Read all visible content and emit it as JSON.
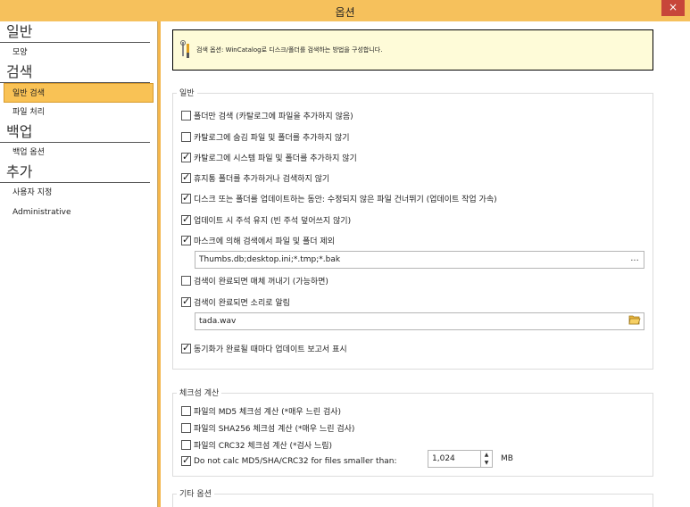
{
  "window": {
    "title": "옵션",
    "close_label": "×"
  },
  "sidebar": {
    "groups": [
      {
        "title": "일반",
        "items": [
          "모양"
        ]
      },
      {
        "title": "검색",
        "items": [
          "일반 검색",
          "파일 처리"
        ]
      },
      {
        "title": "백업",
        "items": [
          "백업 옵션"
        ]
      },
      {
        "title": "추가",
        "items": [
          "사용자 지정",
          "Administrative"
        ]
      }
    ],
    "active_item": "일반 검색"
  },
  "info": {
    "text": "검색 옵션: WinCatalog로 디스크/폴더를 검색하는 방법을 구성합니다."
  },
  "general": {
    "legend": "일반",
    "options": [
      {
        "label": "폴더만 검색 (카탈로그에 파일을 추가하지 않음)",
        "checked": false
      },
      {
        "label": "카탈로그에 숨김 파일 및 폴더를 추가하지 않기",
        "checked": false
      },
      {
        "label": "카탈로그에 시스템 파일 및 폴더를 추가하지 않기",
        "checked": true
      },
      {
        "label": "휴지통 폴더를 추가하거나 검색하지 않기",
        "checked": true
      },
      {
        "label": "디스크 또는 폴더를 업데이트하는 동안: 수정되지 않은 파일 건너뛰기 (업데이트 작업 가속)",
        "checked": true
      },
      {
        "label": "업데이트 시 주석 유지 (빈 주석 덮어쓰지 않기)",
        "checked": true
      },
      {
        "label": "마스크에 의해 검색에서 파일 및 폴더 제외",
        "checked": true
      },
      {
        "label": "검색이 완료되면 매체 꺼내기 (가능하면)",
        "checked": false
      },
      {
        "label": "검색이 완료되면 소리로 알림",
        "checked": true
      },
      {
        "label": "동기화가 완료될 때마다 업데이트 보고서 표시",
        "checked": true
      }
    ],
    "mask_value": "Thumbs.db;desktop.ini;*.tmp;*.bak",
    "mask_button": "...",
    "sound_value": "tada.wav"
  },
  "checksum": {
    "legend": "체크섬 계산",
    "options": [
      {
        "label": "파일의 MD5 체크섬 계산 (*매우 느린 검사)",
        "checked": false
      },
      {
        "label": "파일의 SHA256 체크섬 계산 (*매우 느린 검사)",
        "checked": false
      },
      {
        "label": "파일의 CRC32 체크섬 계산 (*검사 느림)",
        "checked": false
      },
      {
        "label": "Do not calc MD5/SHA/CRC32 for files smaller than:",
        "checked": true
      }
    ],
    "size_value": "1,024",
    "size_unit": "MB"
  },
  "other": {
    "legend": "기타 옵션"
  },
  "icons": [
    "close-icon",
    "wrench-icon",
    "folder-open-icon",
    "ellipsis-icon",
    "spin-up-icon",
    "spin-down-icon",
    "check-icon"
  ],
  "colors": {
    "titlebar": "#f6c15c",
    "accent": "#f9c255",
    "close": "#c7463a",
    "info_bg": "#fefbd8"
  }
}
